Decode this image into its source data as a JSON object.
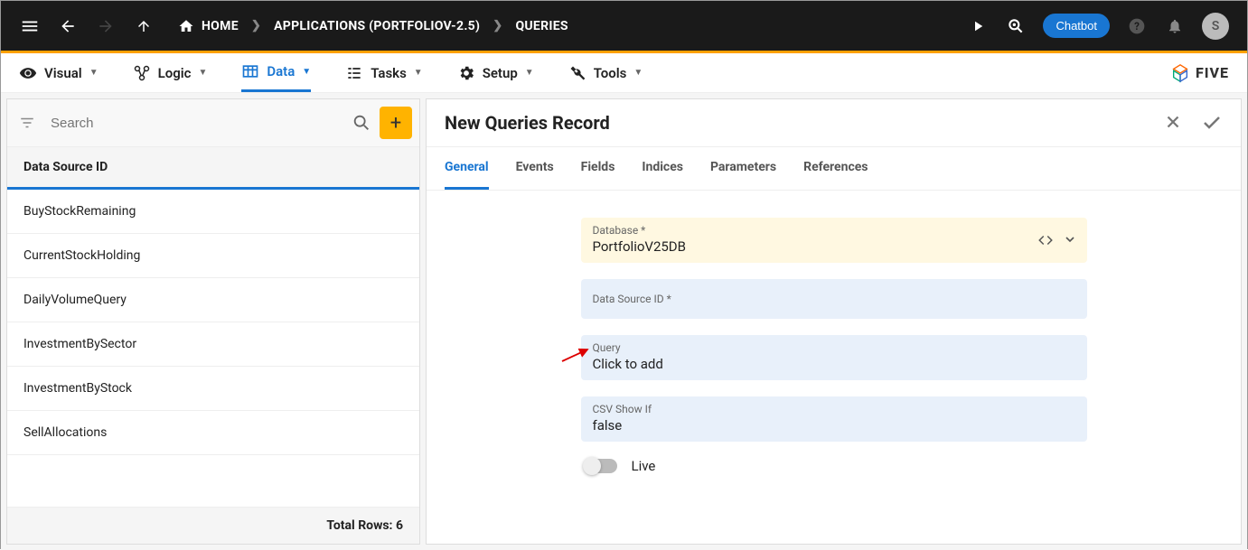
{
  "breadcrumb": {
    "home": "HOME",
    "app": "APPLICATIONS (PORTFOLIOV-2.5)",
    "page": "QUERIES"
  },
  "topbar": {
    "chatbot": "Chatbot",
    "avatar_letter": "S"
  },
  "maintabs": {
    "visual": "Visual",
    "logic": "Logic",
    "data": "Data",
    "tasks": "Tasks",
    "setup": "Setup",
    "tools": "Tools"
  },
  "logo_text": "FIVE",
  "search": {
    "placeholder": "Search"
  },
  "list": {
    "header": "Data Source ID",
    "items": [
      "BuyStockRemaining",
      "CurrentStockHolding",
      "DailyVolumeQuery",
      "InvestmentBySector",
      "InvestmentByStock",
      "SellAllocations"
    ],
    "footer": "Total Rows: 6"
  },
  "form": {
    "title": "New Queries Record",
    "tabs": {
      "general": "General",
      "events": "Events",
      "fields": "Fields",
      "indices": "Indices",
      "parameters": "Parameters",
      "references": "References"
    },
    "fields": {
      "database_label": "Database *",
      "database_value": "PortfolioV25DB",
      "datasource_label": "Data Source ID *",
      "query_label": "Query",
      "query_value": "Click to add",
      "csv_label": "CSV Show If",
      "csv_value": "false",
      "live_label": "Live"
    }
  }
}
